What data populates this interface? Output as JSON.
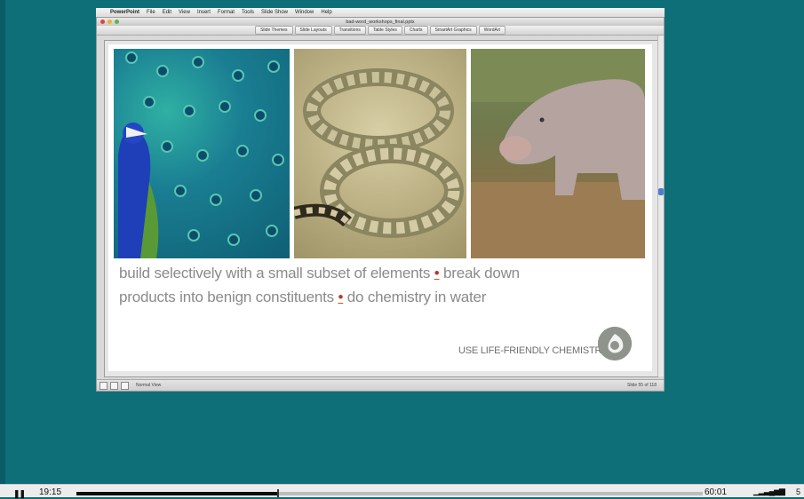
{
  "menubar": {
    "app_name": "PowerPoint",
    "menus": [
      "File",
      "Edit",
      "View",
      "Insert",
      "Format",
      "Tools",
      "Slide Show",
      "Window",
      "Help"
    ]
  },
  "window": {
    "title": "bad-word_workshops_final.pptx",
    "ribbon_tabs": [
      "Slide Themes",
      "Slide Layouts",
      "Transitions",
      "Table Styles",
      "Charts",
      "SmartArt Graphics",
      "WordArt"
    ],
    "status_view": "Normal View",
    "slide_count": "Slide 55 of 118"
  },
  "slide": {
    "line1_a": "build selectively with a small subset of elements",
    "bullet": "•",
    "line1_b": "break down",
    "line2_a": "products into benign constituents",
    "line2_b": "do chemistry in water",
    "tagline": "USE LIFE-FRIENDLY CHEMISTRY"
  },
  "player": {
    "current_time": "19:15",
    "total_time": "60:01",
    "progress": 0.32,
    "extra": "5"
  },
  "colors": {
    "background": "#0e6f79",
    "slide_text": "#8a8a8a",
    "bullet": "#b83a2a"
  },
  "icons": {
    "apple": "apple-logo-icon",
    "pause": "pause-icon",
    "volume": "volume-icon",
    "logo": "biomimicry-logo-icon"
  }
}
